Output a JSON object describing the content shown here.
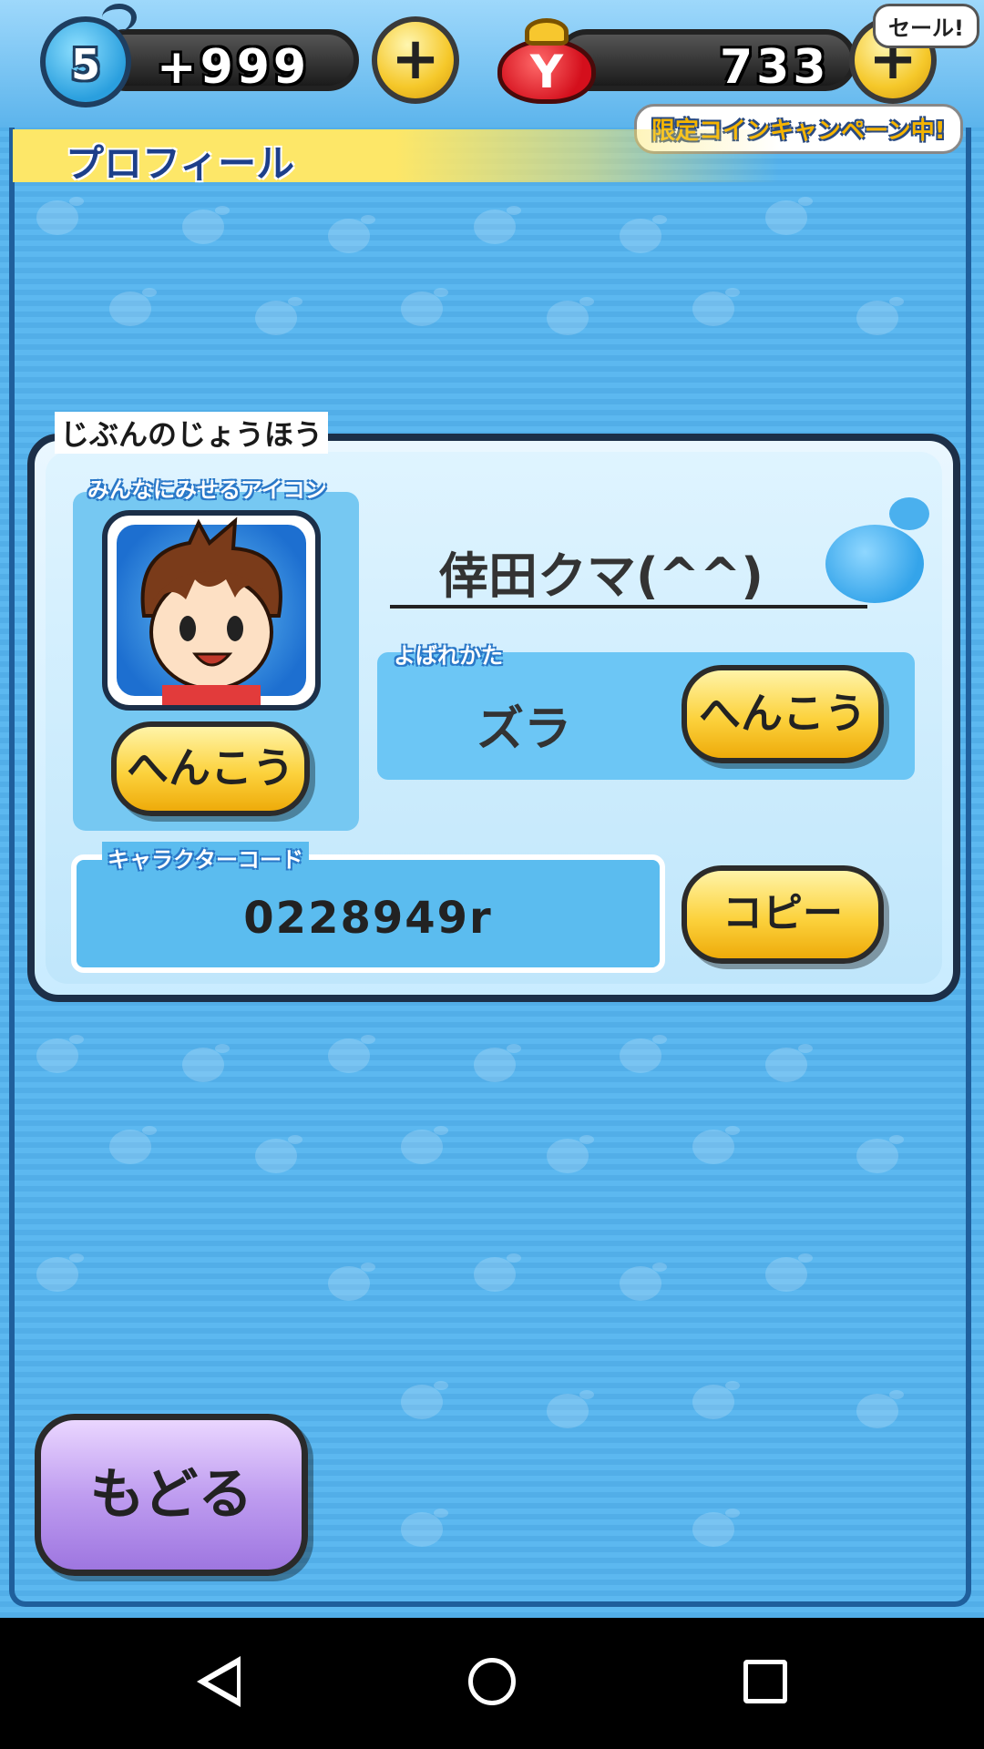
{
  "topbar": {
    "soul_level": "5",
    "soul_points": "+999",
    "coins": "733",
    "purse_letter": "Y",
    "plus_symbol": "+",
    "sale_tag": "セール!",
    "campaign_tag": "限定コインキャンペーン中!"
  },
  "page": {
    "title": "プロフィール"
  },
  "profile": {
    "section_label": "じぶんのじょうほう",
    "icon_label": "みんなにみせるアイコン",
    "icon_change_label": "へんこう",
    "name": "倖田クマ(^^)",
    "nickname_label": "よばれかた",
    "nickname": "ズラ",
    "nickname_change_label": "へんこう",
    "code_label": "キャラクターコード",
    "code": "0228949r",
    "copy_label": "コピー"
  },
  "footer": {
    "back_label": "もどる"
  },
  "colors": {
    "accent_yellow": "#fcd23d",
    "accent_purple": "#bf9df0",
    "panel_border": "#1c2f48",
    "background_blue": "#5cb8f0"
  }
}
